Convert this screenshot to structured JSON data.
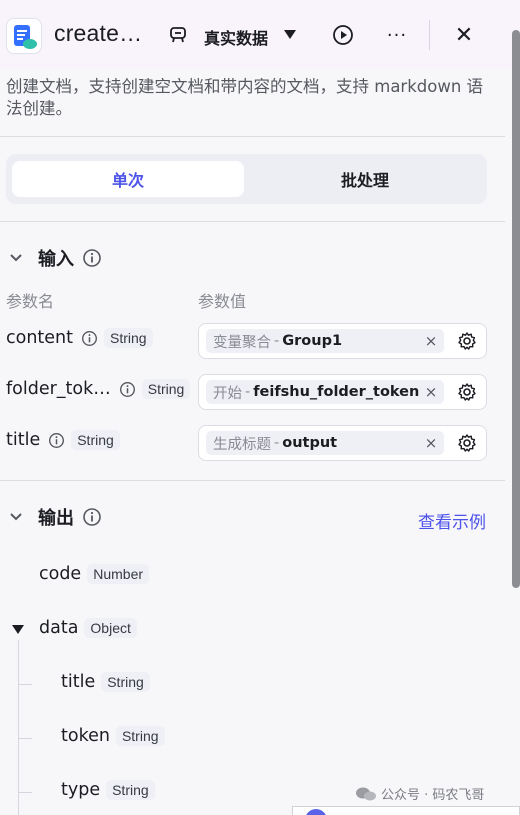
{
  "header": {
    "title": "create…",
    "dataset_label": "真实数据",
    "more_label": "···",
    "close_label": "✕"
  },
  "description": "创建文档，支持创建空文档和带内容的文档，支持 markdown 语法创建。",
  "mode_tabs": [
    {
      "label": "单次",
      "active": true
    },
    {
      "label": "批处理",
      "active": false
    }
  ],
  "input_section": {
    "title": "输入",
    "col_name": "参数名",
    "col_value": "参数值",
    "params": [
      {
        "name": "content",
        "type": "String",
        "source": "变量聚合",
        "sep": "-",
        "variable": "Group1"
      },
      {
        "name": "folder_tok…",
        "type": "String",
        "source": "开始",
        "sep": "-",
        "variable": "feifshu_folder_token"
      },
      {
        "name": "title",
        "type": "String",
        "source": "生成标题",
        "sep": "-",
        "variable": "output"
      }
    ],
    "clear_label": "×"
  },
  "output_section": {
    "title": "输出",
    "example_link": "查看示例",
    "fields": [
      {
        "name": "code",
        "type": "Number"
      },
      {
        "name": "data",
        "type": "Object"
      },
      {
        "name": "title",
        "type": "String"
      },
      {
        "name": "token",
        "type": "String"
      },
      {
        "name": "type",
        "type": "String"
      }
    ]
  },
  "watermark": "公众号 · 码农飞哥",
  "colors": {
    "accent": "#4d53e8",
    "text": "#1c1d23",
    "muted": "#8a8c93"
  },
  "icons": [
    "doc-app-icon",
    "dataset-icon",
    "run-icon",
    "more-icon",
    "close-icon",
    "chevron-down-icon",
    "info-icon",
    "gear-icon",
    "wechat-icon"
  ]
}
